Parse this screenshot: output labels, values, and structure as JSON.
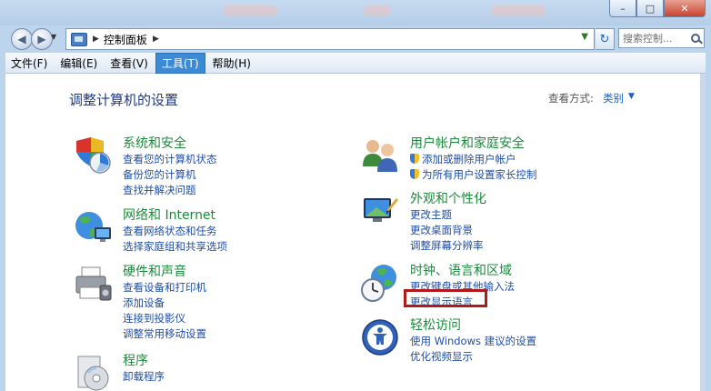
{
  "address": {
    "location": "控制面板"
  },
  "search": {
    "placeholder": "搜索控制..."
  },
  "window_controls": {
    "minimize": "–",
    "maximize": "□",
    "close": "✕"
  },
  "nav": {
    "back": "◀",
    "forward": "▶",
    "refresh": "↻"
  },
  "menu": [
    {
      "label": "文件(F)"
    },
    {
      "label": "编辑(E)"
    },
    {
      "label": "查看(V)"
    },
    {
      "label": "工具(T)",
      "active": true
    },
    {
      "label": "帮助(H)"
    }
  ],
  "page": {
    "title": "调整计算机的设置",
    "view_by_label": "查看方式:",
    "view_by_value": "类别"
  },
  "categories": {
    "system": {
      "title": "系统和安全",
      "icon": "system-security-icon",
      "links": [
        "查看您的计算机状态",
        "备份您的计算机",
        "查找并解决问题"
      ]
    },
    "network": {
      "title": "网络和 Internet",
      "icon": "network-globe-icon",
      "links": [
        "查看网络状态和任务",
        "选择家庭组和共享选项"
      ]
    },
    "hardware": {
      "title": "硬件和声音",
      "icon": "printer-icon",
      "links": [
        "查看设备和打印机",
        "添加设备",
        "连接到投影仪",
        "调整常用移动设置"
      ]
    },
    "programs": {
      "title": "程序",
      "icon": "programs-disc-icon",
      "links": [
        "卸载程序"
      ]
    },
    "users": {
      "title": "用户帐户和家庭安全",
      "icon": "users-icon",
      "links": [
        "添加或删除用户帐户",
        "为所有用户设置家长控制"
      ]
    },
    "appearance": {
      "title": "外观和个性化",
      "icon": "display-personalize-icon",
      "links": [
        "更改主题",
        "更改桌面背景",
        "调整屏幕分辨率"
      ]
    },
    "clock": {
      "title": "时钟、语言和区域",
      "icon": "clock-globe-icon",
      "links": [
        "更改键盘或其他输入法",
        "更改显示语言"
      ]
    },
    "access": {
      "title": "轻松访问",
      "icon": "ease-of-access-icon",
      "links": [
        "使用 Windows 建议的设置",
        "优化视频显示"
      ]
    }
  },
  "colors": {
    "category_title": "#1c8a3d",
    "link": "#1f4ea8",
    "highlight_box": "#b11a1a",
    "active_menu": "#3a8ad6"
  }
}
